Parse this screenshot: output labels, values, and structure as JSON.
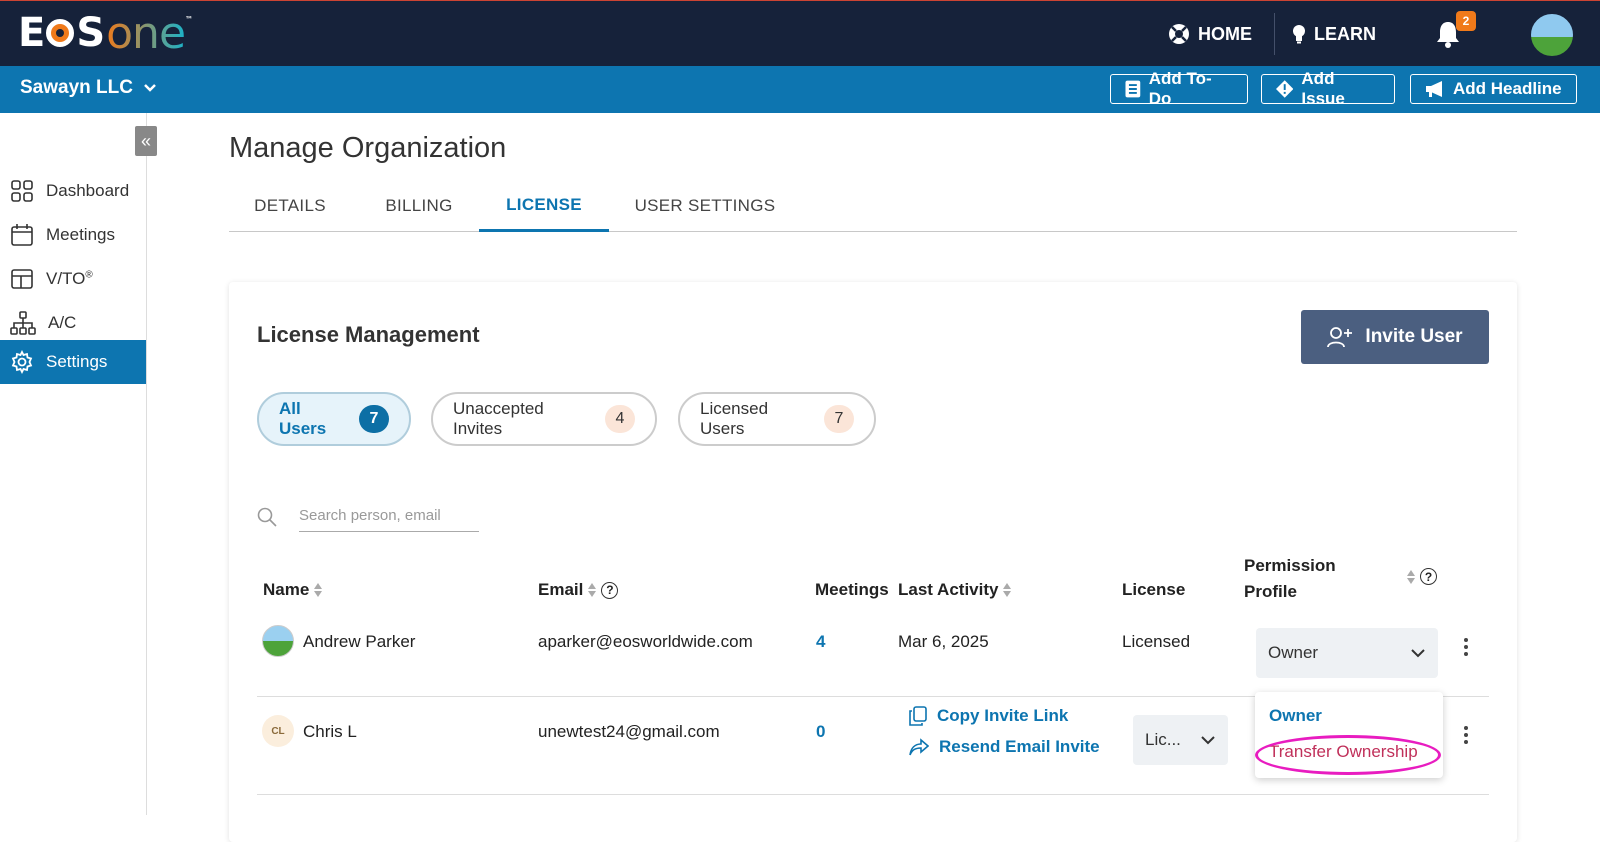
{
  "app": {
    "logo": "EOSone",
    "nav": {
      "home": "HOME",
      "learn": "LEARN"
    },
    "notifications_count": "2"
  },
  "org_bar": {
    "org_name": "Sawayn LLC",
    "add_todo": "Add To-Do",
    "add_issue": "Add Issue",
    "add_headline": "Add Headline"
  },
  "sidebar": {
    "items": [
      {
        "label": "Dashboard",
        "icon": "grid-icon"
      },
      {
        "label": "Meetings",
        "icon": "calendar-icon"
      },
      {
        "label": "V/TO",
        "sup": "®",
        "icon": "layout-icon"
      },
      {
        "label": "A/C",
        "icon": "org-chart-icon"
      },
      {
        "label": "Settings",
        "icon": "gear-icon",
        "active": true
      }
    ]
  },
  "page": {
    "title": "Manage Organization",
    "tabs": [
      "DETAILS",
      "BILLING",
      "LICENSE",
      "USER SETTINGS"
    ],
    "active_tab": "LICENSE"
  },
  "license": {
    "title": "License Management",
    "invite_button": "Invite User",
    "filters": [
      {
        "label": "All Users",
        "count": "7"
      },
      {
        "label": "Unaccepted Invites",
        "count": "4"
      },
      {
        "label": "Licensed Users",
        "count": "7"
      }
    ],
    "search_placeholder": "Search person, email",
    "columns": {
      "name": "Name",
      "email": "Email",
      "meetings": "Meetings",
      "last_activity": "Last Activity",
      "license": "License",
      "permission_line1": "Permission",
      "permission_line2": "Profile"
    },
    "rows": [
      {
        "name": "Andrew Parker",
        "email": "aparker@eosworldwide.com",
        "meetings": "4",
        "last_activity": "Mar 6, 2025",
        "license": "Licensed",
        "permission": "Owner"
      },
      {
        "initials": "CL",
        "name": "Chris L",
        "email": "unewtest24@gmail.com",
        "meetings": "0",
        "copy_invite": "Copy Invite Link",
        "resend_invite": "Resend Email Invite",
        "license": "Lic..."
      }
    ],
    "permission_dropdown": {
      "options": [
        "Owner",
        "Transfer Ownership"
      ]
    }
  },
  "colors": {
    "topbar": "#16223a",
    "subbar": "#0d75b0",
    "accent": "#f07a1a",
    "highlight": "#e81cc0"
  }
}
